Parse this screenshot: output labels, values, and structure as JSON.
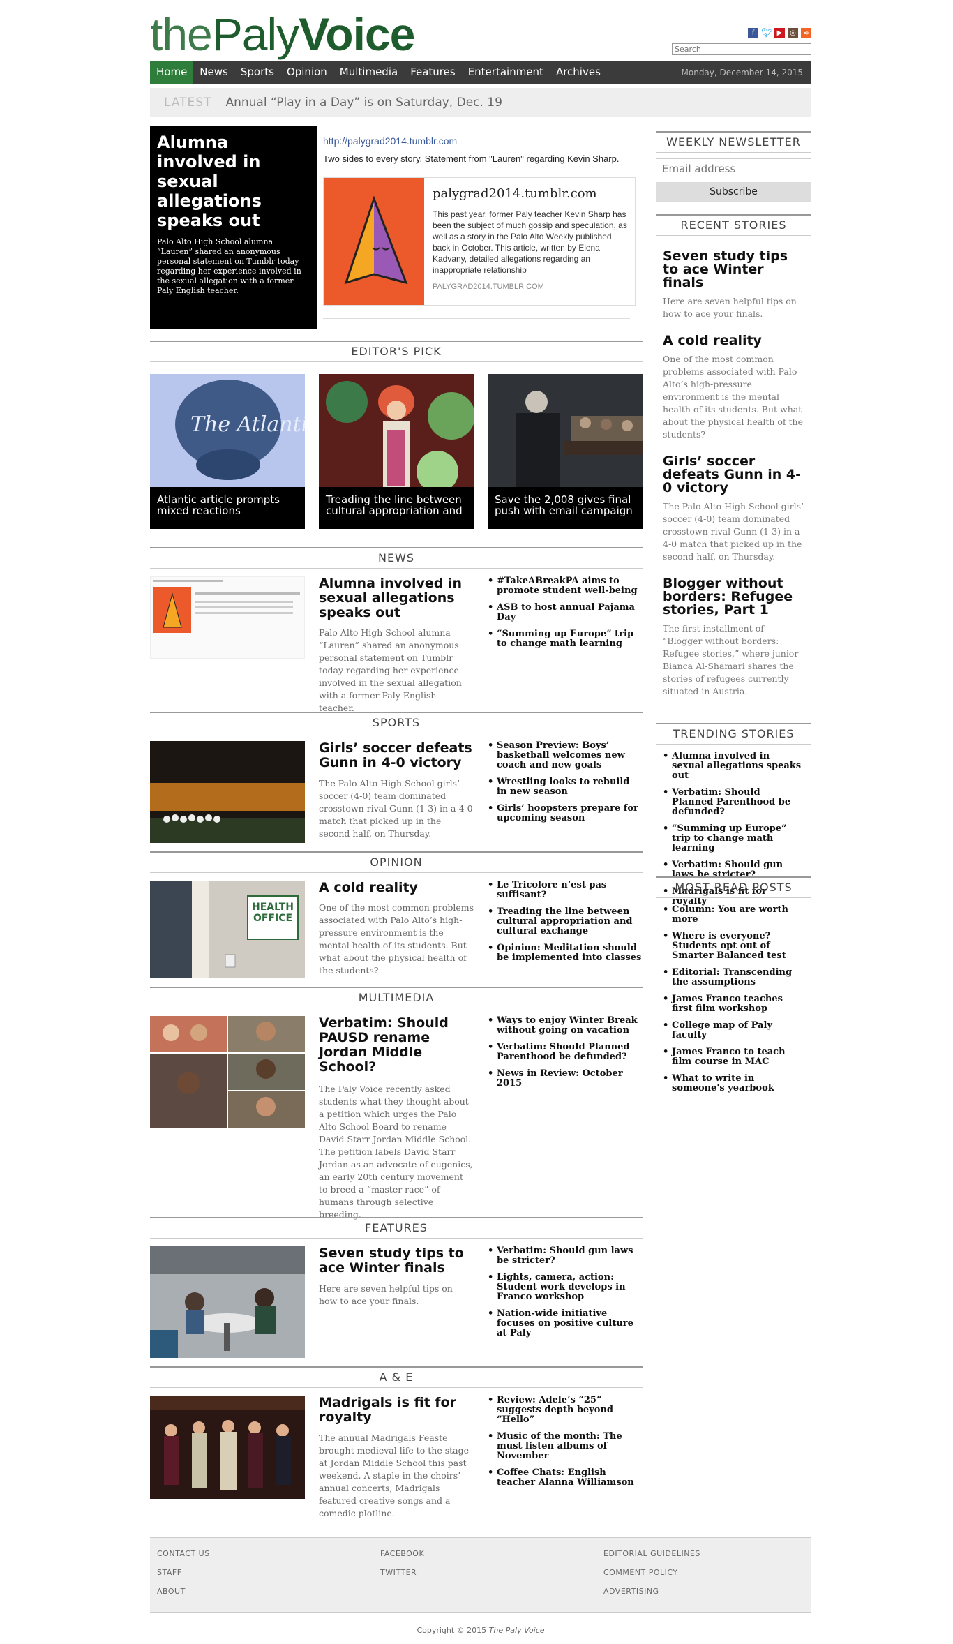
{
  "brand": {
    "logo_the": "the",
    "logo_paly": "Paly",
    "logo_voice": "Voice"
  },
  "header": {
    "search_placeholder": "Search",
    "social": [
      "facebook-icon",
      "twitter-icon",
      "youtube-icon",
      "instagram-icon",
      "rss-icon"
    ]
  },
  "nav": {
    "items": [
      "Home",
      "News",
      "Sports",
      "Opinion",
      "Multimedia",
      "Features",
      "Entertainment",
      "Archives"
    ],
    "date": "Monday, December 14, 2015"
  },
  "latest": {
    "label": "LATEST",
    "text": "Annual “Play in a Day” is on Saturday, Dec. 19"
  },
  "hero": {
    "title": "Alumna involved in sexual allegations speaks out",
    "summary": "Palo Alto High School alumna “Lauren” shared an anonymous personal statement on Tumblr today regarding her experience involved in the sexual allegation with a former Paly English teacher.",
    "embed_url": "http://palygrad2014.tumblr.com",
    "embed_desc": "Two sides to every story. Statement from \"Lauren\" regarding Kevin Sharp.",
    "card_title": "palygrad2014.tumblr.com",
    "card_text": "This past year, former Paly teacher Kevin Sharp has been the subject of much gossip and speculation, as well as a story in the Palo Alto Weekly published back in October. This article, written by Elena Kadvany, detailed allegations regarding an inappropriate relationship",
    "card_foot": "PALYGRAD2014.TUMBLR.COM"
  },
  "sections": {
    "editors_pick": "EDITOR'S PICK",
    "news": "NEWS",
    "sports": "SPORTS",
    "opinion": "OPINION",
    "multimedia": "MULTIMEDIA",
    "features": "FEATURES",
    "ae": "A & E"
  },
  "editors_pick": [
    {
      "caption": "Atlantic article prompts mixed reactions",
      "logo": "The Atlantic"
    },
    {
      "caption": "Treading the line between cultural appropriation and"
    },
    {
      "caption": "Save the 2,008 gives final push with email campaign"
    }
  ],
  "news": {
    "title": "Alumna involved in sexual allegations speaks out",
    "summary": "Palo Alto High School alumna “Lauren” shared an anonymous personal statement on Tumblr today regarding her experience involved in the sexual allegation with a former Paly English teacher.",
    "links": [
      "#TakeABreakPA aims to promote student well-being",
      "ASB to host annual Pajama Day",
      "“Summing up Europe” trip to change math learning"
    ]
  },
  "sports": {
    "title": "Girls’ soccer defeats Gunn in 4-0 victory",
    "summary": "The Palo Alto High School girls’ soccer (4-0) team dominated crosstown rival Gunn (1-3) in a 4-0 match that picked up in the second half, on Thursday.",
    "links": [
      "Season Preview: Boys’ basketball welcomes new coach and new goals",
      "Wrestling looks to rebuild in new season",
      "Girls’ hoopsters prepare for upcoming season"
    ]
  },
  "opinion": {
    "title": "A cold reality",
    "summary": "One of the most common problems associated with Palo Alto’s high-pressure environment is the mental health of its students. But what about the physical health of the students?",
    "sign": "HEALTH OFFICE",
    "links": [
      "Le Tricolore n’est pas suffisant?",
      "Treading the line between cultural appropriation and cultural exchange",
      "Opinion: Meditation should be implemented into classes"
    ]
  },
  "multimedia": {
    "title": "Verbatim: Should PAUSD rename Jordan Middle School?",
    "summary": "The Paly Voice recently asked students what they thought about a petition which urges the Palo Alto School Board to rename David Starr Jordan Middle School. The petition labels David Starr Jordan as an advocate of eugenics, an early 20th century movement to breed a “master race” of humans through selective breeding.",
    "links": [
      "Ways to enjoy Winter Break without going on vacation",
      "Verbatim: Should Planned Parenthood be defunded?",
      "News in Review: October 2015"
    ]
  },
  "features": {
    "title": "Seven study tips to ace Winter finals",
    "summary": "Here are seven helpful tips on how to ace your finals.",
    "links": [
      "Verbatim: Should gun laws be stricter?",
      "Lights, camera, action: Student work develops in Franco workshop",
      "Nation-wide initiative focuses on positive culture at Paly"
    ]
  },
  "ae": {
    "title": "Madrigals is fit for royalty",
    "summary": "The annual Madrigals Feaste brought medieval life to the stage at Jordan Middle School this past weekend. A staple in the choirs’ annual concerts, Madrigals featured creative songs and a comedic plotline.",
    "links": [
      "Review: Adele’s “25” suggests depth beyond “Hello”",
      "Music of the month: The must listen albums of November",
      "Coffee Chats: English teacher Alanna Williamson"
    ]
  },
  "sidebar": {
    "newsletter_head": "WEEKLY NEWSLETTER",
    "email_placeholder": "Email address",
    "subscribe": "Subscribe",
    "recent_head": "RECENT STORIES",
    "recent": [
      {
        "title": "Seven study tips to ace Winter finals",
        "summary": "Here are seven helpful tips on how to ace your finals."
      },
      {
        "title": "A cold reality",
        "summary": "One of the most common problems associated with Palo Alto’s high-pressure environment is the mental health of its students. But what about the physical health of the students?"
      },
      {
        "title": "Girls’ soccer defeats Gunn in 4-0 victory",
        "summary": "The Palo Alto High School girls’ soccer (4-0) team dominated crosstown rival Gunn (1-3) in a 4-0 match that picked up in the second half, on Thursday."
      },
      {
        "title": "Blogger without borders: Refugee stories, Part 1",
        "summary": "The first installment of “Blogger without borders: Refugee stories,” where junior Bianca Al-Shamari shares the stories of refugees currently situated in Austria."
      }
    ],
    "trending_head": "TRENDING STORIES",
    "trending": [
      "Alumna involved in sexual allegations speaks out",
      "Verbatim: Should Planned Parenthood be defunded?",
      "“Summing up Europe” trip to change math learning",
      "Verbatim: Should gun laws be stricter?",
      "Madrigals is fit for royalty"
    ],
    "most_read_head": "MOST READ POSTS",
    "most_read": [
      "Column: You are worth more",
      "Where is everyone? Students opt out of Smarter Balanced test",
      "Editorial: Transcending the assumptions",
      "James Franco teaches first film workshop",
      "College map of Paly faculty",
      "James Franco to teach film course in MAC",
      "What to write in someone's yearbook"
    ]
  },
  "footer": {
    "col1": [
      "CONTACT US",
      "STAFF",
      "ABOUT"
    ],
    "col2": [
      "FACEBOOK",
      "TWITTER"
    ],
    "col3": [
      "EDITORIAL GUIDELINES",
      "COMMENT POLICY",
      "ADVERTISING"
    ],
    "copyright_prefix": "Copyright © 2015 ",
    "copyright_name": "The Paly Voice"
  },
  "colors": {
    "brand_green": "#1e5c2e",
    "nav_bg": "#3b3b3b",
    "nav_active": "#2e7d3a"
  }
}
